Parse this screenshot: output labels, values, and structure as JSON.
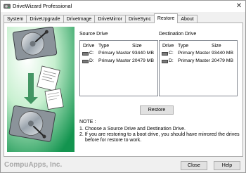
{
  "window": {
    "title": "DriveWizard Professional"
  },
  "tabs": [
    {
      "label": "System"
    },
    {
      "label": "DriveUpgrade"
    },
    {
      "label": "DriveImage"
    },
    {
      "label": "DriveMirror"
    },
    {
      "label": "DriveSync"
    },
    {
      "label": "Restore"
    },
    {
      "label": "About"
    }
  ],
  "active_tab": "Restore",
  "source": {
    "label": "Source Drive",
    "columns": [
      "Drive",
      "Type",
      "Size"
    ],
    "rows": [
      {
        "drive": "C:",
        "type": "Primary Master",
        "size": "93440 MB"
      },
      {
        "drive": "D:",
        "type": "Primary Master",
        "size": "20479 MB"
      }
    ]
  },
  "destination": {
    "label": "Destination Drive",
    "columns": [
      "Drive",
      "Type",
      "Size"
    ],
    "rows": [
      {
        "drive": "C:",
        "type": "Primary Master",
        "size": "93440 MB"
      },
      {
        "drive": "D:",
        "type": "Primary Master",
        "size": "20479 MB"
      }
    ]
  },
  "restore_button": "Restore",
  "note": {
    "heading": "NOTE :",
    "line1": "1. Choose a Source Drive and Destination Drive.",
    "line2": "2. If you are restoring to a boot drive, you should have mirrored the drives",
    "line3": "before for restore to work."
  },
  "footer": {
    "brand": "CompuApps, Inc.",
    "close_button": "Close",
    "help_button": "Help"
  },
  "colors": {
    "art_green": "#1aa35b",
    "brand_grey": "#a8a8a8"
  },
  "icons": {
    "app": "hard-drive-icon",
    "drive": "hard-drive-icon",
    "close": "close-icon"
  }
}
